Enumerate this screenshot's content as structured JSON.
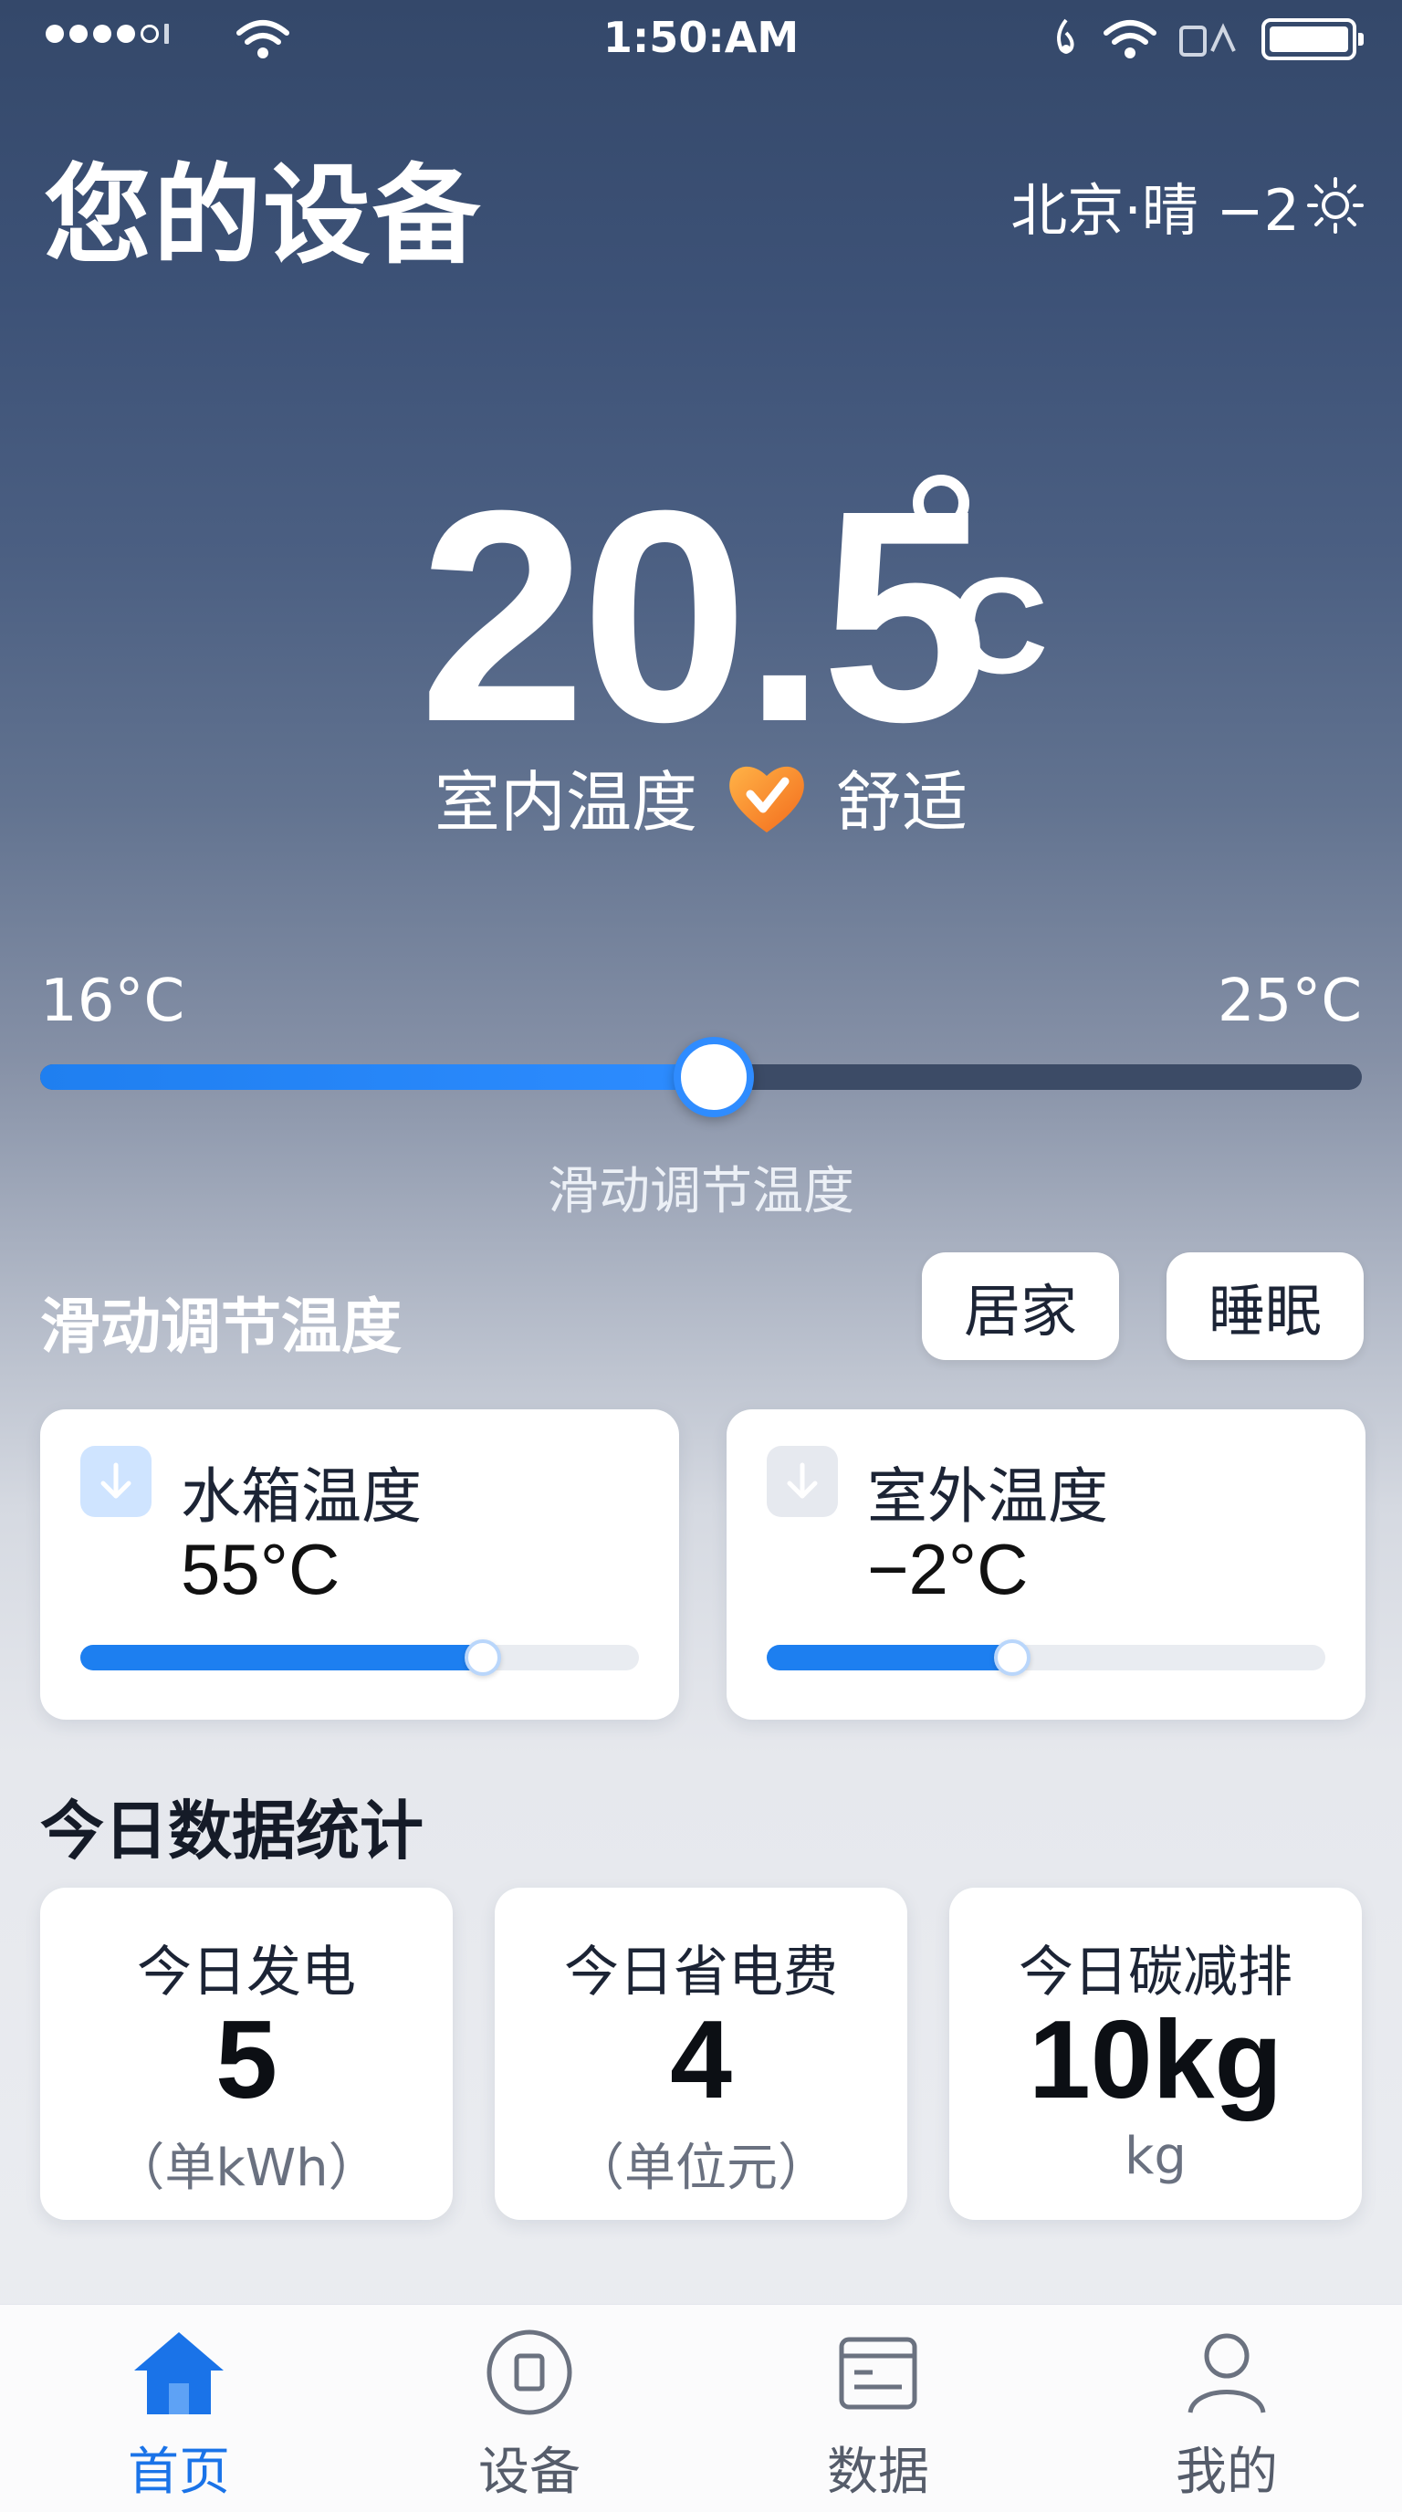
{
  "status_bar": {
    "time": "1:50:AM"
  },
  "header": {
    "title": "您的设备",
    "weather": "北京·晴 −2",
    "weather_icon": "sun-icon"
  },
  "indoor": {
    "temperature": "20.5",
    "unit": "C",
    "label": "室内温度",
    "comfort": "舒适"
  },
  "slider": {
    "min_label": "16°C",
    "max_label": "25°C",
    "hint": "滑动调节温度",
    "accent": "#2d8cff"
  },
  "mode_section": {
    "title": "滑动调节温度",
    "buttons": [
      "居家",
      "睡眠"
    ]
  },
  "temp_cards": [
    {
      "label": "水箱温度",
      "value": "55°C",
      "icon": "arrow-down-icon"
    },
    {
      "label": "室外温度",
      "value": "−2°C",
      "icon": "arrow-down-icon"
    }
  ],
  "stats": {
    "title": "今日数据统计",
    "items": [
      {
        "label": "今日发电",
        "value": "5",
        "unit": "（单kWh）"
      },
      {
        "label": "今日省电费",
        "value": "4",
        "unit": "（单位元）"
      },
      {
        "label": "今日碳减排",
        "value": "10kg",
        "unit": "kg"
      }
    ]
  },
  "nav": [
    {
      "label": "首页",
      "icon": "home-icon",
      "active": true
    },
    {
      "label": "设备",
      "icon": "device-icon",
      "active": false
    },
    {
      "label": "数据",
      "icon": "data-icon",
      "active": false
    },
    {
      "label": "我的",
      "icon": "user-icon",
      "active": false
    }
  ],
  "colors": {
    "accent": "#1a73e8"
  }
}
